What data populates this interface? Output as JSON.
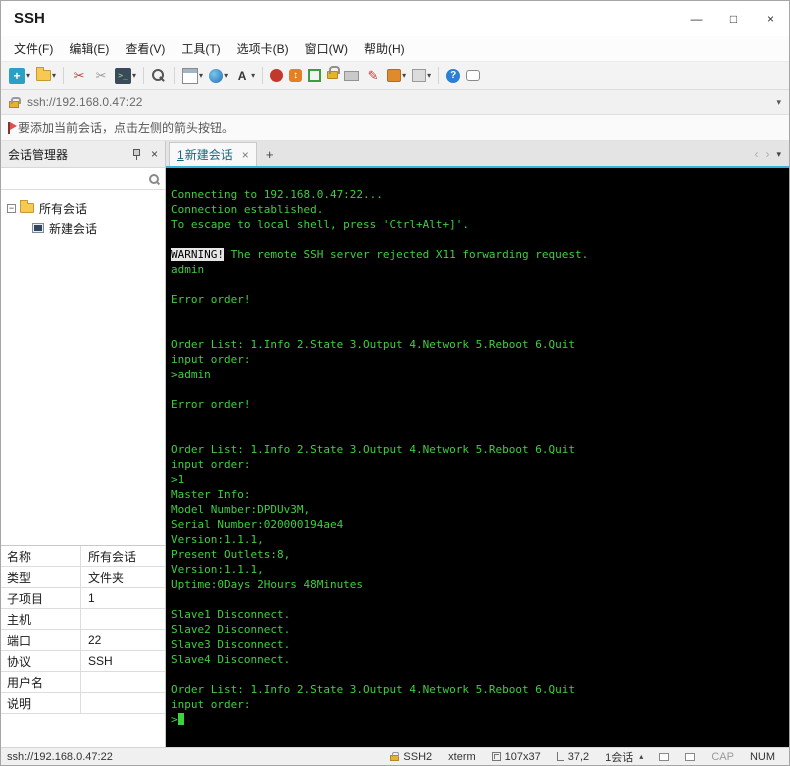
{
  "theme": {
    "tab_accent": "#35b3d8",
    "terminal_background": "#000000",
    "terminal_foreground": "#3fcf3f"
  },
  "window": {
    "title": "SSH",
    "controls": [
      {
        "id": "minimize",
        "glyph": "—"
      },
      {
        "id": "maximize",
        "glyph": "□"
      },
      {
        "id": "close",
        "glyph": "×"
      }
    ]
  },
  "menu_bar": {
    "items": [
      {
        "id": "file",
        "label": "文件(F)"
      },
      {
        "id": "edit",
        "label": "编辑(E)"
      },
      {
        "id": "view",
        "label": "查看(V)"
      },
      {
        "id": "tools",
        "label": "工具(T)"
      },
      {
        "id": "tabs",
        "label": "选项卡(B)"
      },
      {
        "id": "window",
        "label": "窗口(W)"
      },
      {
        "id": "help",
        "label": "帮助(H)"
      }
    ]
  },
  "toolbar": {
    "items": [
      {
        "name": "new-session-icon",
        "dropdown": true
      },
      {
        "name": "open-folder-icon",
        "dropdown": true
      },
      {
        "sep": true
      },
      {
        "name": "disconnect-icon"
      },
      {
        "name": "reconnect-icon"
      },
      {
        "name": "duplicate-session-icon",
        "dropdown": true
      },
      {
        "sep": true
      },
      {
        "name": "find-icon"
      },
      {
        "sep": true
      },
      {
        "name": "tab-layout-icon",
        "dropdown": true
      },
      {
        "name": "web-icon",
        "dropdown": true
      },
      {
        "name": "font-icon",
        "dropdown": true
      },
      {
        "sep": true
      },
      {
        "name": "xagent-icon"
      },
      {
        "name": "xftp-icon"
      },
      {
        "name": "fullscreen-icon"
      },
      {
        "name": "lock-icon"
      },
      {
        "name": "keyboard-icon"
      },
      {
        "name": "compose-icon"
      },
      {
        "name": "transfer-icon",
        "dropdown": true
      },
      {
        "name": "panes-icon",
        "dropdown": true
      },
      {
        "sep": true
      },
      {
        "name": "help-icon"
      },
      {
        "name": "feedback-icon"
      }
    ]
  },
  "address_bar": {
    "url": "ssh://192.168.0.47:22"
  },
  "notice_bar": {
    "text": "要添加当前会话，点击左侧的箭头按钮。"
  },
  "session_manager": {
    "title": "会话管理器",
    "search_value": "",
    "tree": {
      "root_label": "所有会话",
      "child_label": "新建会话"
    },
    "properties": [
      {
        "label": "名称",
        "value": "所有会话"
      },
      {
        "label": "类型",
        "value": "文件夹"
      },
      {
        "label": "子项目",
        "value": "1"
      },
      {
        "label": "主机",
        "value": ""
      },
      {
        "label": "端口",
        "value": "22"
      },
      {
        "label": "协议",
        "value": "SSH"
      },
      {
        "label": "用户名",
        "value": ""
      },
      {
        "label": "说明",
        "value": ""
      }
    ]
  },
  "tab_bar": {
    "active_tab": {
      "number": "1",
      "label": "新建会话"
    },
    "add_label": "+"
  },
  "terminal": {
    "lines": [
      "Connecting to 192.168.0.47:22...",
      "Connection established.",
      "To escape to local shell, press 'Ctrl+Alt+]'.",
      "",
      {
        "segments": [
          {
            "t": "WARNING!",
            "inverse": true
          },
          {
            "t": " The remote SSH server rejected X11 forwarding request."
          }
        ]
      },
      "admin",
      "",
      "Error order!",
      "",
      "",
      "Order List: 1.Info 2.State 3.Output 4.Network 5.Reboot 6.Quit",
      "input order:",
      ">admin",
      "",
      "Error order!",
      "",
      "",
      "Order List: 1.Info 2.State 3.Output 4.Network 5.Reboot 6.Quit",
      "input order:",
      ">1",
      "Master Info:",
      "Model Number:DPDUv3M,",
      "Serial Number:020000194ae4",
      "Version:1.1.1,",
      "Present Outlets:8,",
      "Version:1.1.1,",
      "Uptime:0Days 2Hours 48Minutes",
      "",
      "Slave1 Disconnect.",
      "Slave2 Disconnect.",
      "Slave3 Disconnect.",
      "Slave4 Disconnect.",
      "",
      "Order List: 1.Info 2.State 3.Output 4.Network 5.Reboot 6.Quit",
      "input order:",
      {
        "segments": [
          {
            "t": ">"
          }
        ],
        "cursor": true
      }
    ]
  },
  "status_bar": {
    "session_url": "ssh://192.168.0.47:22",
    "items": [
      {
        "name": "protocol",
        "icon": "status-lock-icon",
        "label": "SSH2"
      },
      {
        "name": "terminal-type",
        "label": "xterm"
      },
      {
        "name": "terminal-size",
        "icon": "size-icon",
        "label": "107x37"
      },
      {
        "name": "cursor-position",
        "icon": "position-icon",
        "label": "37,2"
      },
      {
        "name": "session-count",
        "label": "1会话",
        "caret": true
      },
      {
        "name": "pane-toggle-1",
        "icon": "panel-icon"
      },
      {
        "name": "pane-toggle-2",
        "icon": "panel-icon"
      },
      {
        "name": "caps-lock",
        "label": "CAP",
        "muted": true,
        "indicator": true
      },
      {
        "name": "num-lock",
        "label": "NUM",
        "indicator": true
      }
    ]
  }
}
